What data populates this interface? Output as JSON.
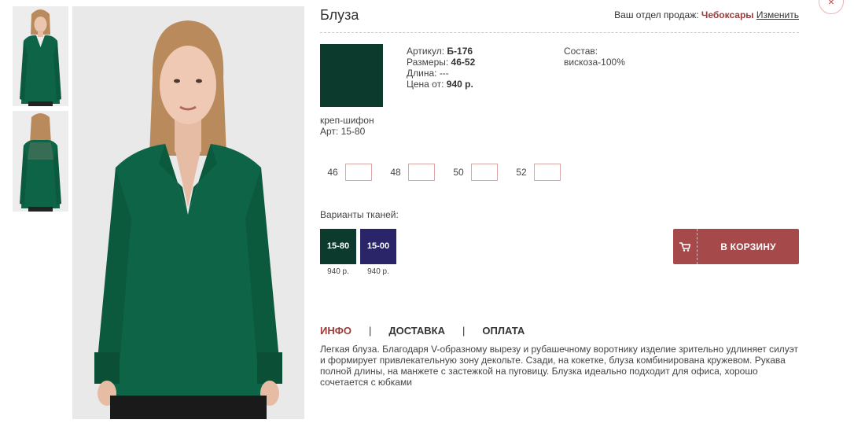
{
  "product": {
    "title": "Блуза",
    "article_label": "Артикул:",
    "article_value": "Б-176",
    "sizes_label": "Размеры:",
    "sizes_value": "46-52",
    "length_label": "Длина:",
    "length_value": "---",
    "price_label": "Цена от:",
    "price_value": "940 р.",
    "composition_label": "Состав:",
    "composition_value": "вискоза-100%"
  },
  "dept": {
    "label": "Ваш отдел продаж:",
    "city": "Чебоксары",
    "change": "Изменить"
  },
  "close_icon": "×",
  "fabric": {
    "name": "креп-шифон",
    "article": "Арт: 15-80",
    "color": "#0c3b2d"
  },
  "size_inputs": [
    {
      "label": "46",
      "value": ""
    },
    {
      "label": "48",
      "value": ""
    },
    {
      "label": "50",
      "value": ""
    },
    {
      "label": "52",
      "value": ""
    }
  ],
  "variants": {
    "label": "Варианты тканей:",
    "items": [
      {
        "code": "15-80",
        "price": "940 р.",
        "color": "#0c3b2d"
      },
      {
        "code": "15-00",
        "price": "940 р.",
        "color": "#2a2469"
      }
    ]
  },
  "cart": {
    "label": "В КОРЗИНУ",
    "icon": "cart-icon"
  },
  "tabs": {
    "info": "ИНФО",
    "delivery": "ДОСТАВКА",
    "payment": "ОПЛАТА",
    "separator": "|"
  },
  "description": "Легкая блуза. Благодаря V-образному вырезу и рубашечному воротнику изделие зрительно удлиняет силуэт и формирует привлекательную зону декольте. Сзади, на кокетке, блуза комбинирована кружевом. Рукава полной длины, на манжете с застежкой на пуговицу. Блузка идеально подходит для офиса, хорошо сочетается с юбками",
  "colors": {
    "accent": "#9b3b3b",
    "button": "#a6494b",
    "blouse": "#0e6446",
    "photo_bg": "#e8e8e8"
  }
}
